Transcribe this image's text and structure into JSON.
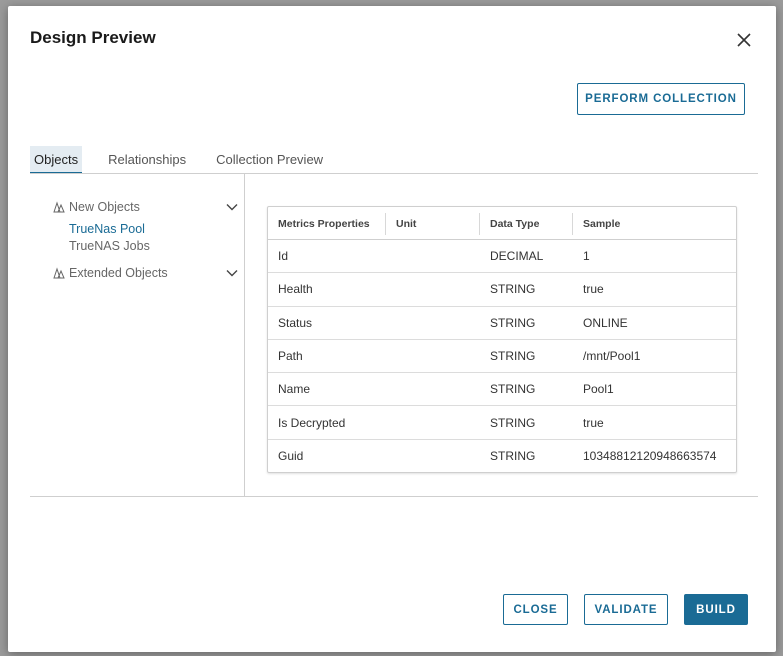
{
  "dialog": {
    "title": "Design Preview",
    "perform_collection_label": "PERFORM COLLECTION"
  },
  "tabs": [
    {
      "label": "Objects",
      "active": true
    },
    {
      "label": "Relationships",
      "active": false
    },
    {
      "label": "Collection Preview",
      "active": false
    }
  ],
  "tree": {
    "new_objects": {
      "label": "New Objects",
      "icon": "objects-icon",
      "items": [
        "TrueNas Pool",
        "TrueNAS Jobs"
      ],
      "selected": "TrueNas Pool"
    },
    "extended_objects": {
      "label": "Extended Objects",
      "icon": "objects-icon"
    }
  },
  "table": {
    "columns": [
      "Metrics Properties",
      "Unit",
      "Data Type",
      "Sample"
    ],
    "rows": [
      [
        "Id",
        "",
        "DECIMAL",
        "1"
      ],
      [
        "Health",
        "",
        "STRING",
        "true"
      ],
      [
        "Status",
        "",
        "STRING",
        "ONLINE"
      ],
      [
        "Path",
        "",
        "STRING",
        "/mnt/Pool1"
      ],
      [
        "Name",
        "",
        "STRING",
        "Pool1"
      ],
      [
        "Is Decrypted",
        "",
        "STRING",
        "true"
      ],
      [
        "Guid",
        "",
        "STRING",
        "10348812120948663574"
      ]
    ]
  },
  "footer": {
    "close_label": "CLOSE",
    "validate_label": "VALIDATE",
    "build_label": "BUILD"
  },
  "colors": {
    "accent": "#1a6b95",
    "tab_active_bg": "#e4ecf2"
  }
}
